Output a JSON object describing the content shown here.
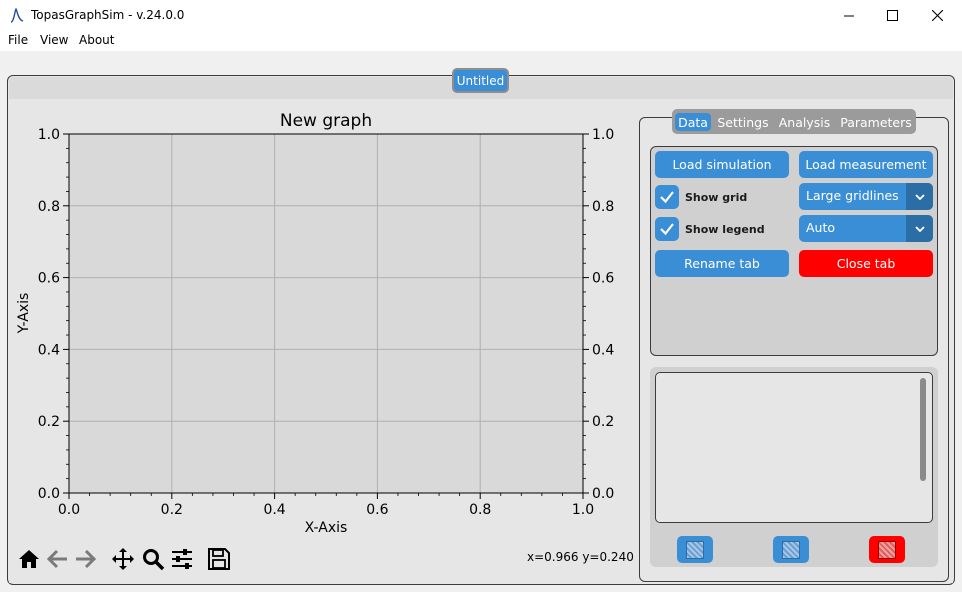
{
  "window": {
    "title": "TopasGraphSim - v.24.0.0"
  },
  "menu": [
    "File",
    "View",
    "About"
  ],
  "graph_tab": {
    "label": "Untitled"
  },
  "plot": {
    "title": "New graph",
    "xlabel": "X-Axis",
    "ylabel": "Y-Axis",
    "x_ticks": [
      "0.0",
      "0.2",
      "0.4",
      "0.6",
      "0.8",
      "1.0"
    ],
    "y_ticks": [
      "0.0",
      "0.2",
      "0.4",
      "0.6",
      "0.8",
      "1.0"
    ],
    "xlim": [
      0,
      1
    ],
    "ylim": [
      0,
      1
    ],
    "grid": true,
    "background": "#d9d9d9",
    "grid_color": "#b0b0b0"
  },
  "toolbar": {
    "icons": [
      "home-icon",
      "back-arrow-icon",
      "forward-arrow-icon",
      "pan-move-icon",
      "zoom-magnifier-icon",
      "configure-subplots-icon",
      "save-floppy-icon"
    ],
    "coords": "x=0.966 y=0.240"
  },
  "side_tabs": [
    "Data",
    "Settings",
    "Analysis",
    "Parameters"
  ],
  "active_side_tab": "Data",
  "data_panel": {
    "load_simulation": "Load simulation",
    "load_measurement": "Load measurement",
    "show_grid": "Show grid",
    "show_grid_checked": true,
    "grid_option": "Large gridlines",
    "show_legend": "Show legend",
    "show_legend_checked": true,
    "legend_option": "Auto",
    "rename_tab": "Rename tab",
    "close_tab": "Close tab"
  },
  "colors": {
    "accent": "#3a8ed6",
    "danger": "#ff0000",
    "panel": "#d0d0d0",
    "frame": "#e6e6e6"
  }
}
